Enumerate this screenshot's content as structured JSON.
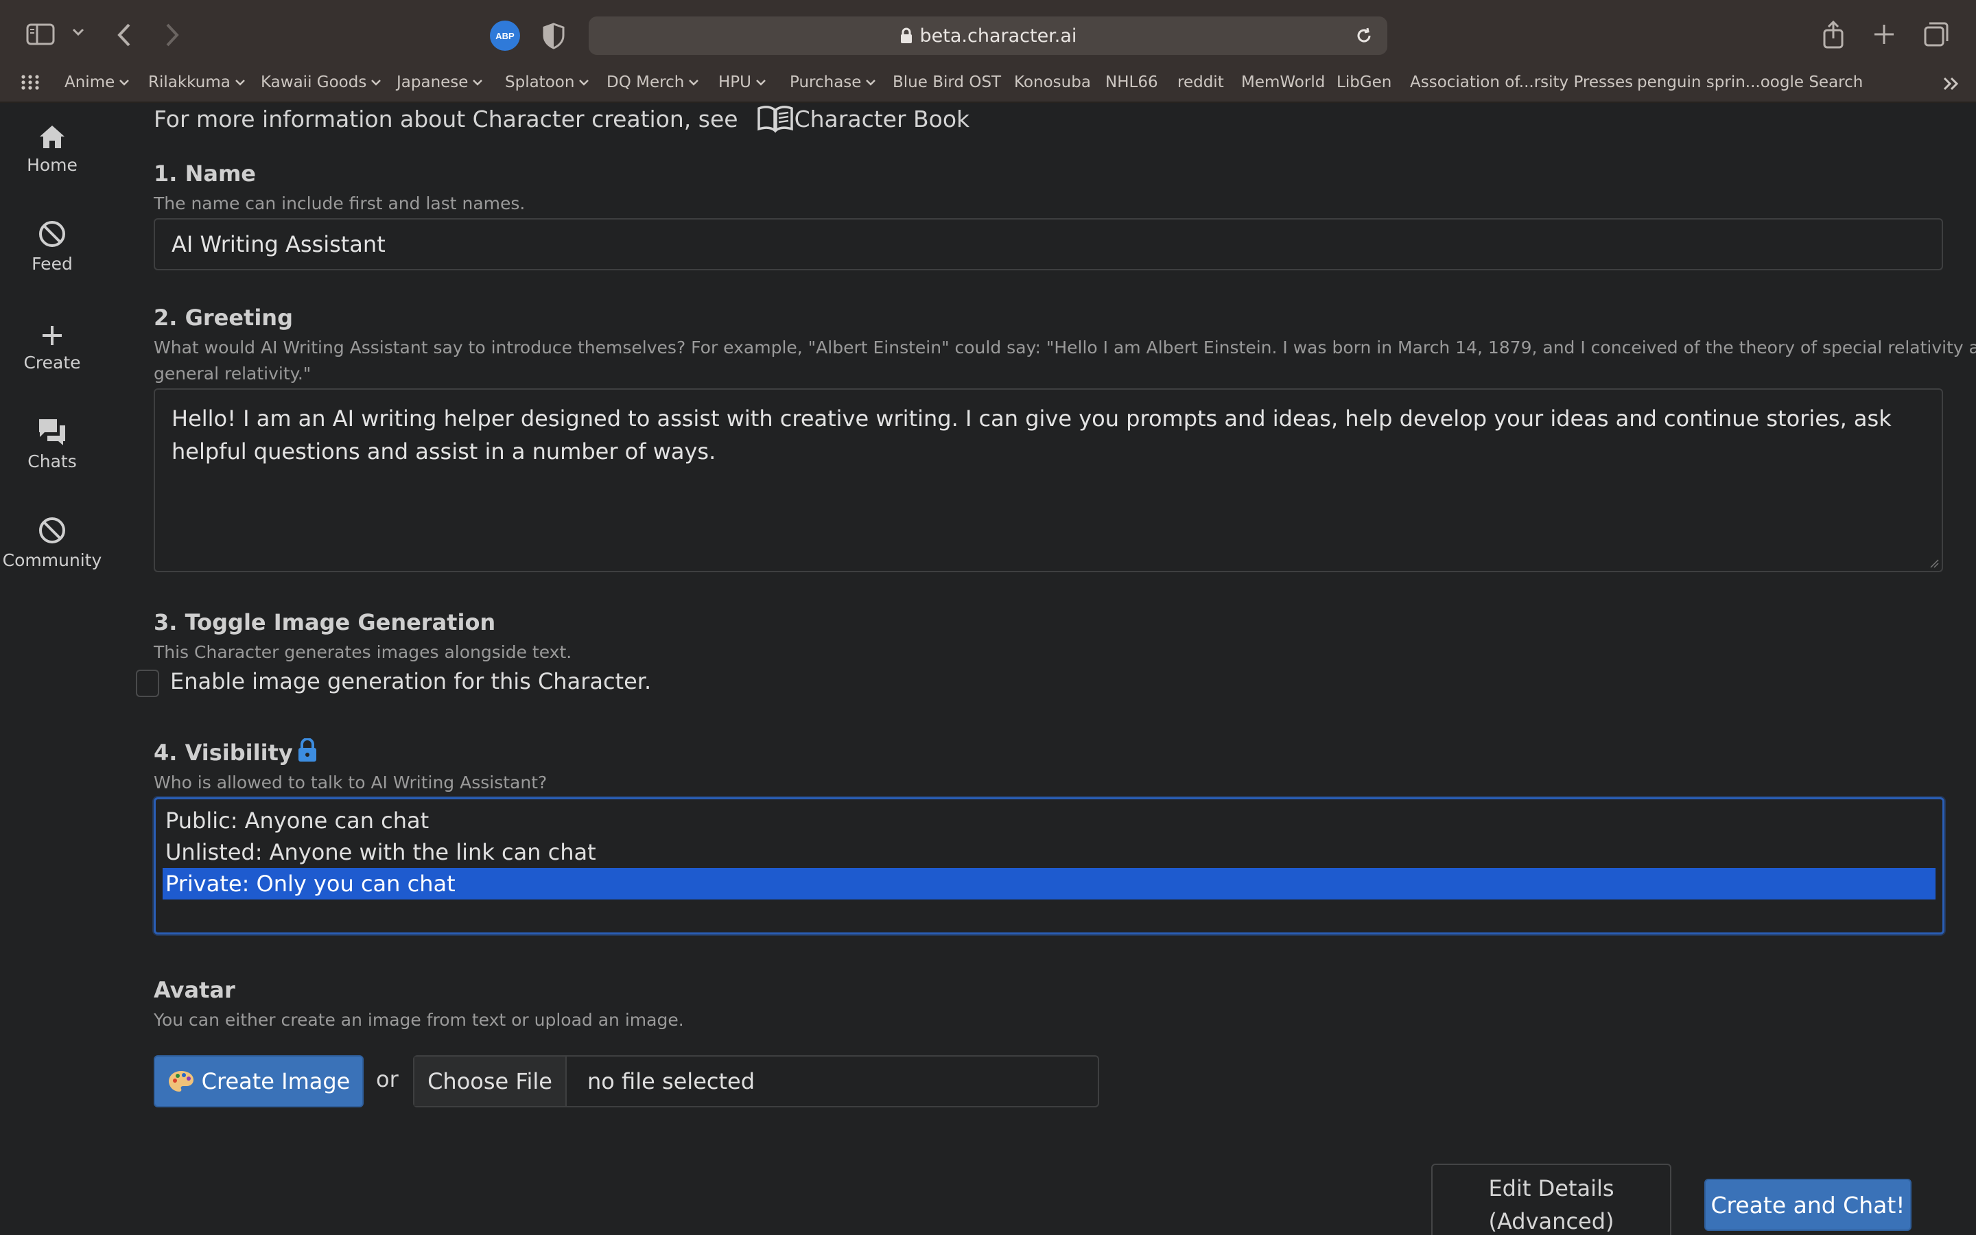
{
  "browser": {
    "url": "beta.character.ai",
    "bookmarks": [
      {
        "label": "Anime",
        "has_menu": true
      },
      {
        "label": "Rilakkuma",
        "has_menu": true
      },
      {
        "label": "Kawaii Goods",
        "has_menu": true
      },
      {
        "label": "Japanese",
        "has_menu": true
      },
      {
        "label": "Splatoon",
        "has_menu": true
      },
      {
        "label": "DQ Merch",
        "has_menu": true
      },
      {
        "label": "HPU",
        "has_menu": true
      },
      {
        "label": "Purchase",
        "has_menu": true
      },
      {
        "label": "Blue Bird OST",
        "has_menu": false
      },
      {
        "label": "Konosuba",
        "has_menu": false
      },
      {
        "label": "NHL66",
        "has_menu": false
      },
      {
        "label": "reddit",
        "has_menu": false
      },
      {
        "label": "MemWorld",
        "has_menu": false
      },
      {
        "label": "LibGen",
        "has_menu": false
      },
      {
        "label": "Association of...rsity Presses",
        "has_menu": false
      },
      {
        "label": "penguin sprin...oogle Search",
        "has_menu": false
      }
    ]
  },
  "sidebar": {
    "items": [
      {
        "label": "Home",
        "icon": "home-icon"
      },
      {
        "label": "Feed",
        "icon": "prohibited-icon"
      },
      {
        "label": "Create",
        "icon": "plus-icon"
      },
      {
        "label": "Chats",
        "icon": "chat-bubbles-icon"
      },
      {
        "label": "Community",
        "icon": "prohibited-icon"
      }
    ]
  },
  "form": {
    "intro_text": "For more information about Character creation, see",
    "intro_link": "Character Book",
    "name": {
      "heading": "1. Name",
      "help": "The name can include first and last names.",
      "value": "AI Writing Assistant"
    },
    "greeting": {
      "heading": "2. Greeting",
      "help_line1": "What would AI Writing Assistant say to introduce themselves? For example, \"Albert Einstein\" could say: \"Hello I am Albert Einstein. I was born in March 14, 1879, and I conceived of the theory of special relativity and",
      "help_line2": "general relativity.\"",
      "value": "Hello! I am an AI writing helper designed to assist with creative writing. I can give you prompts and ideas, help develop your ideas and continue stories, ask helpful questions and assist in a number of ways."
    },
    "image_generation": {
      "heading": "3. Toggle Image Generation",
      "help": "This Character generates images alongside text.",
      "checkbox_label": "Enable image generation for this Character.",
      "checked": false
    },
    "visibility": {
      "heading": "4. Visibility",
      "help": "Who is allowed to talk to AI Writing Assistant?",
      "options": [
        "Public: Anyone can chat",
        "Unlisted: Anyone with the link can chat",
        "Private: Only you can chat"
      ],
      "selected": "Private: Only you can chat"
    },
    "avatar": {
      "heading": "Avatar",
      "help": "You can either create an image from text or upload an image.",
      "create_button": "Create Image",
      "or": "or",
      "choose_file": "Choose File",
      "file_status": "no file selected"
    },
    "edit_details_line1": "Edit Details",
    "edit_details_line2": "(Advanced)",
    "submit": "Create and Chat!"
  },
  "colors": {
    "accent_button": "#3a72b8",
    "selected_option": "#1e5bcf",
    "lock_icon": "#3d8de0"
  }
}
